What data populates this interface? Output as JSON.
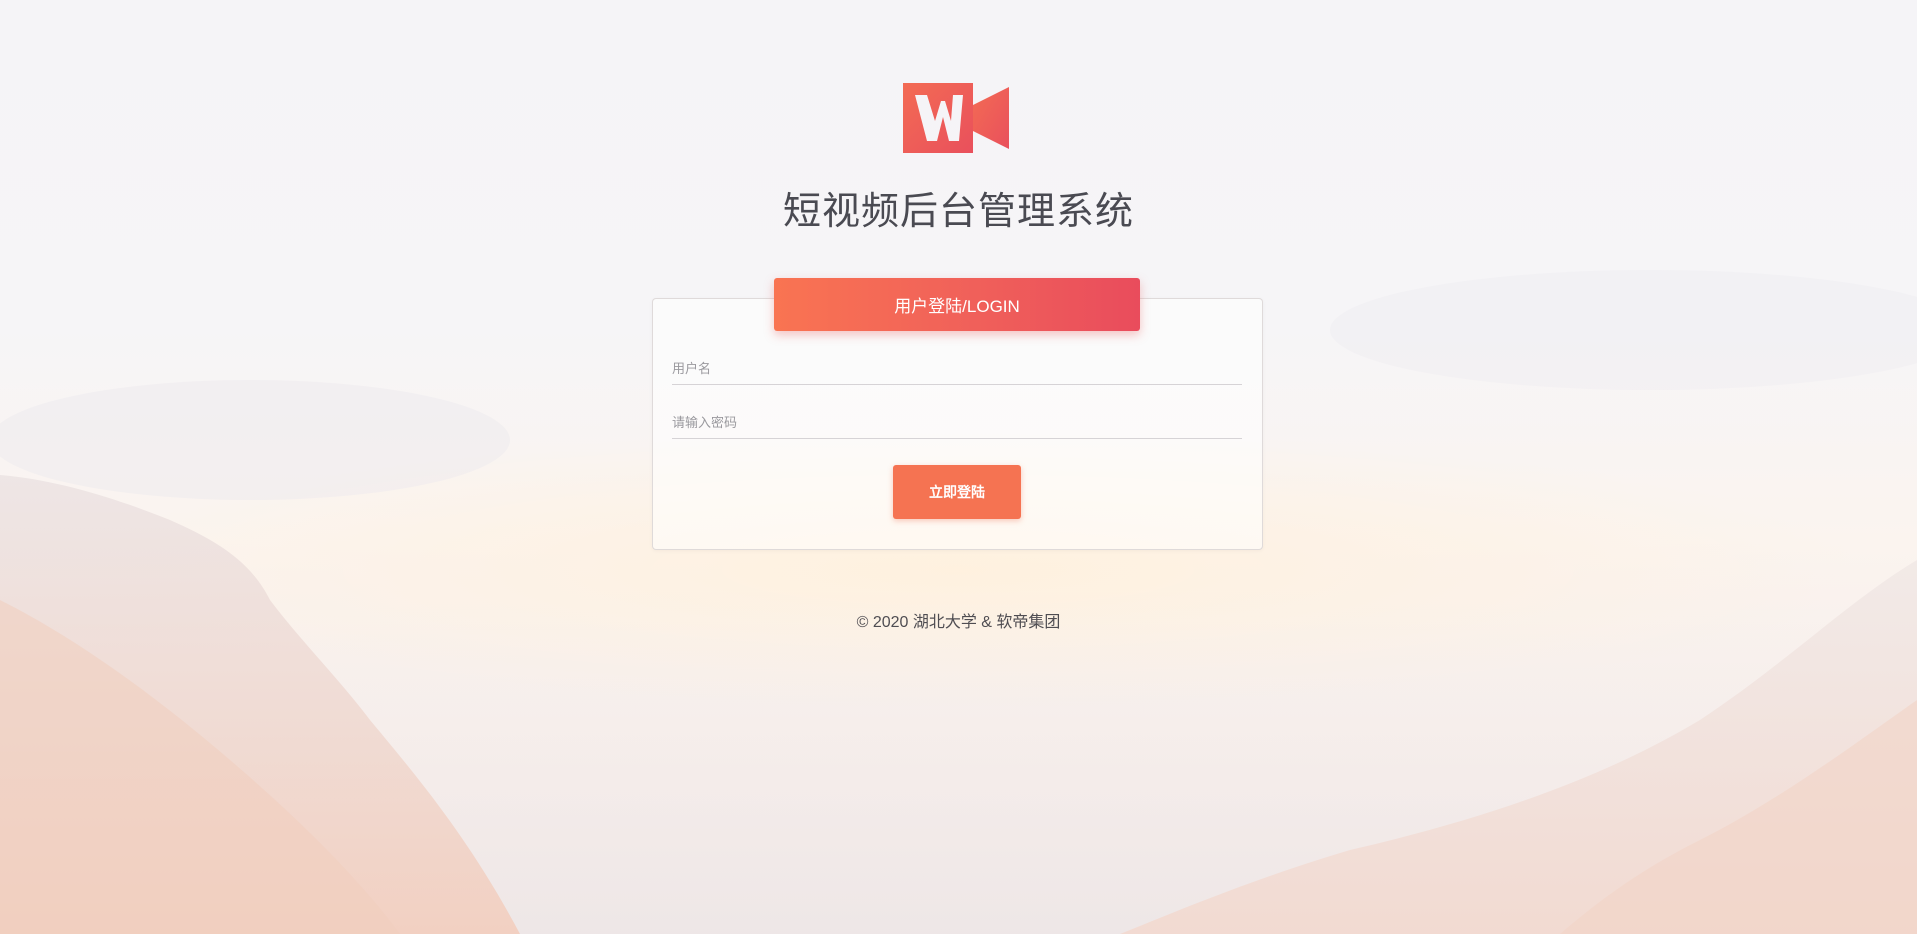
{
  "app": {
    "title": "短视频后台管理系统"
  },
  "logo": {
    "icon": "video-camera-w-logo",
    "color_start": "#f36b54",
    "color_end": "#e9505c"
  },
  "login": {
    "header": "用户登陆/LOGIN",
    "username_placeholder": "用户名",
    "password_placeholder": "请输入密码",
    "submit_label": "立即登陆"
  },
  "footer": {
    "copyright": "© 2020 湖北大学 & 软帝集团"
  },
  "colors": {
    "accent": "#f57352",
    "header_gradient_start": "#f97452",
    "header_gradient_end": "#e94c5c"
  }
}
